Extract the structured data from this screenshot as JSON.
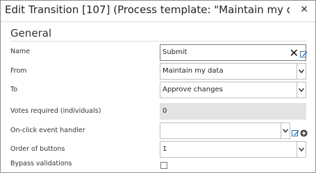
{
  "dialog": {
    "title": "Edit Transition [107] (Process template: \"Maintain my data [10...",
    "close_glyph": "✕"
  },
  "section": {
    "title": "General"
  },
  "fields": {
    "name": {
      "label": "Name",
      "value": "Submit",
      "clear_glyph": "✕"
    },
    "from": {
      "label": "From",
      "value": "Maintain my data"
    },
    "to": {
      "label": "To",
      "value": "Approve changes"
    },
    "votes": {
      "label": "Votes required (individuals)",
      "value": "0"
    },
    "onclick": {
      "label": "On-click event handler",
      "value": ""
    },
    "order": {
      "label": "Order of buttons",
      "value": "1"
    },
    "bypass": {
      "label": "Bypass validations",
      "checked": false
    }
  },
  "icons": {
    "edit": "edit-icon",
    "add": "add-circle-icon",
    "chevron": "chevron-down-icon"
  },
  "colors": {
    "accent_blue": "#2f6fb0",
    "readonly_bg": "#e3e3e3"
  }
}
